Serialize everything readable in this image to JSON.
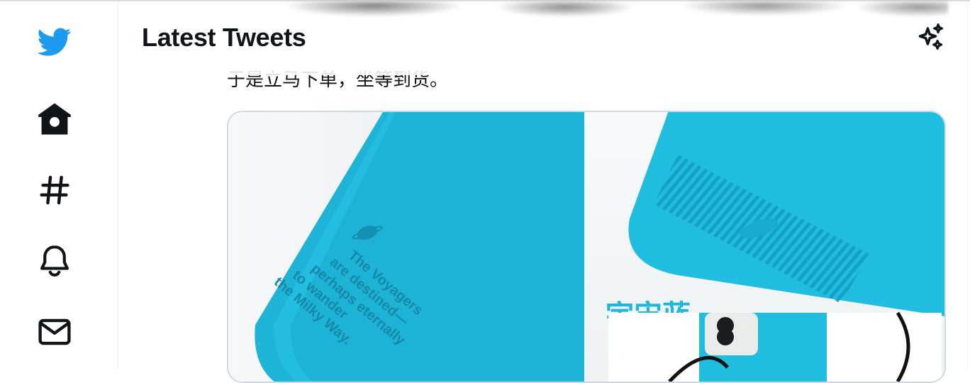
{
  "app": {
    "name": "Twitter"
  },
  "header": {
    "title": "Latest Tweets",
    "sparkle_icon": "sparkle-icon"
  },
  "sidebar": {
    "items": [
      {
        "icon": "twitter-bird-icon",
        "color": "#1d9bf0"
      },
      {
        "icon": "home-icon"
      },
      {
        "icon": "hashtag-icon"
      },
      {
        "icon": "bell-icon"
      },
      {
        "icon": "mail-icon"
      }
    ]
  },
  "tweet": {
    "text": "于是立马下单，坐等到货。",
    "media": {
      "left": {
        "case_color": "#1fb8dc",
        "engraved_text": [
          "The Voyagers",
          "are destined—",
          "perhaps eternally",
          "to wander",
          "the Milky Way."
        ]
      },
      "right": {
        "case_color": "#1fbde0",
        "overlay_text": "宇宙蓝"
      }
    }
  },
  "colors": {
    "accent": "#1d9bf0",
    "text": "#0f1419",
    "border": "#eff3f4"
  }
}
